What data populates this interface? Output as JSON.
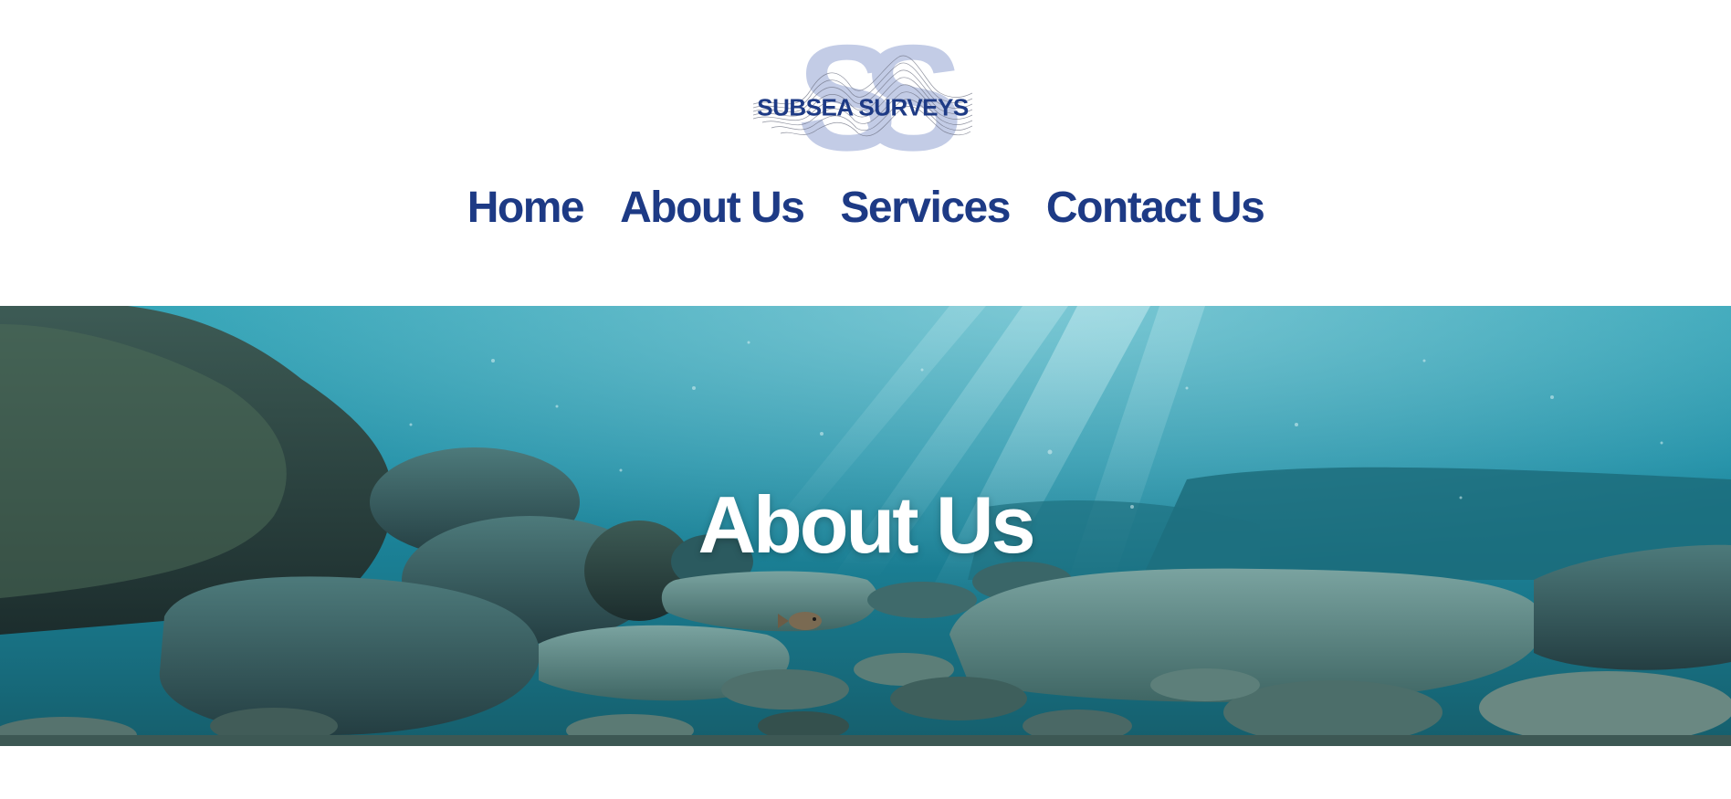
{
  "brand": {
    "logo_text": "SUBSEA SURVEYS",
    "primary_color": "#1d3a85",
    "logo_shape_color": "#c3cce6"
  },
  "nav": {
    "items": [
      {
        "label": "Home"
      },
      {
        "label": "About Us"
      },
      {
        "label": "Services"
      },
      {
        "label": "Contact Us"
      }
    ]
  },
  "hero": {
    "title": "About Us",
    "image": "underwater-seabed-rocks-sunrays"
  }
}
